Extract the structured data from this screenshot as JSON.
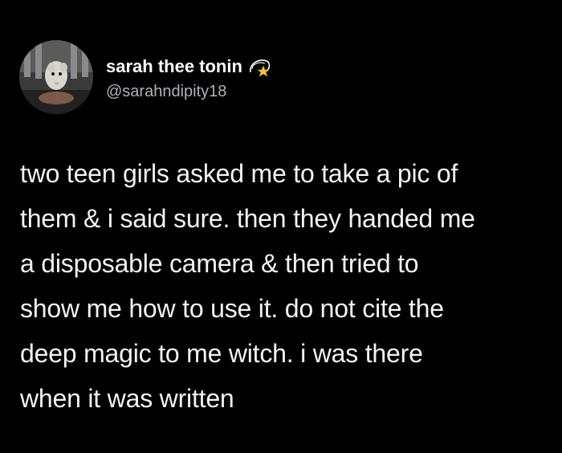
{
  "header": {
    "display_name": "sarah thee tonin",
    "handle": "@sarahndipity18",
    "name_emoji": "dizzy-star-icon"
  },
  "tweet": {
    "lines": [
      "two teen girls asked me to take a pic of",
      "them & i said sure. then they handed me",
      "a disposable camera & then tried to",
      "show me how to use it. do not cite the",
      "deep magic to me witch. i was there",
      "when it was written"
    ]
  },
  "colors": {
    "background": "#000000",
    "text": "#f3f3f3",
    "handle": "#aeb2b6"
  }
}
